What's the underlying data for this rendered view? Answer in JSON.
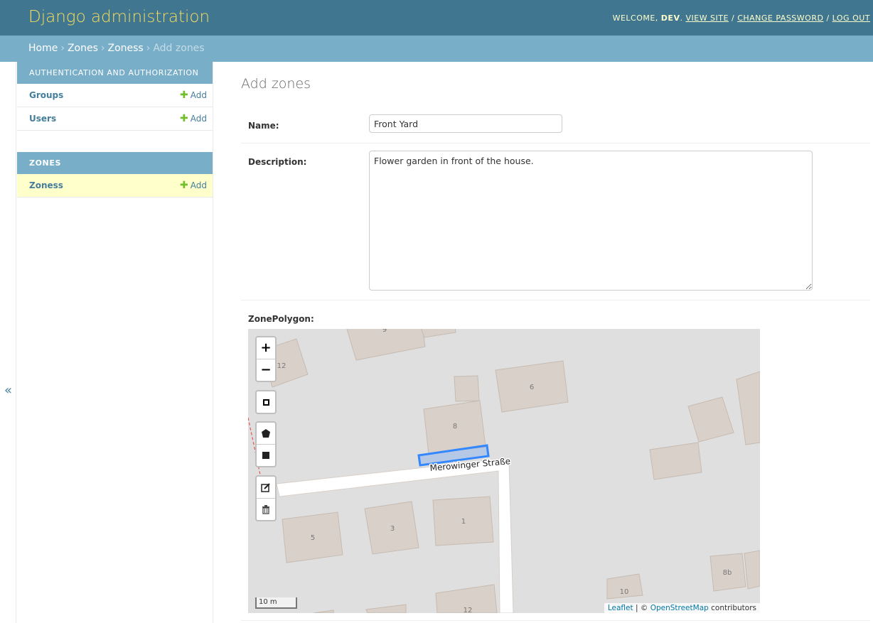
{
  "header": {
    "site_title": "Django administration",
    "welcome": "WELCOME,",
    "user": "DEV",
    "view_site": "VIEW SITE",
    "change_password": "CHANGE PASSWORD",
    "log_out": "LOG OUT",
    "sep": "/"
  },
  "breadcrumbs": {
    "home": "Home",
    "app": "Zones",
    "model": "Zoness",
    "current": "Add zones",
    "sep": "›"
  },
  "sidebar": {
    "toggle": "«",
    "modules": [
      {
        "caption": "AUTHENTICATION AND AUTHORIZATION",
        "rows": [
          {
            "label": "Groups",
            "add": "Add"
          },
          {
            "label": "Users",
            "add": "Add"
          }
        ]
      },
      {
        "caption": "ZONES",
        "rows": [
          {
            "label": "Zoness",
            "add": "Add"
          }
        ]
      }
    ]
  },
  "form": {
    "title": "Add zones",
    "name_label": "Name:",
    "name_value": "Front Yard",
    "description_label": "Description:",
    "description_value": "Flower garden in front of the house.",
    "polygon_label": "ZonePolygon:"
  },
  "map": {
    "zoom_in": "+",
    "zoom_out": "−",
    "street": "Merowinger Straße",
    "house_numbers": [
      "9",
      "12",
      "6",
      "8",
      "5",
      "3",
      "1",
      "10",
      "12",
      "8b"
    ],
    "scale": "10 m",
    "attribution": {
      "leaflet": "Leaflet",
      "sep": " | © ",
      "osm": "OpenStreetMap",
      "contributors": " contributors"
    },
    "drawn_polygon_color": "#3388ff",
    "building_color": "#d9d0c9",
    "road_color": "#ffffff",
    "icons": [
      "square-marker-icon",
      "polygon-icon",
      "rectangle-icon",
      "edit-icon",
      "trash-icon"
    ]
  }
}
